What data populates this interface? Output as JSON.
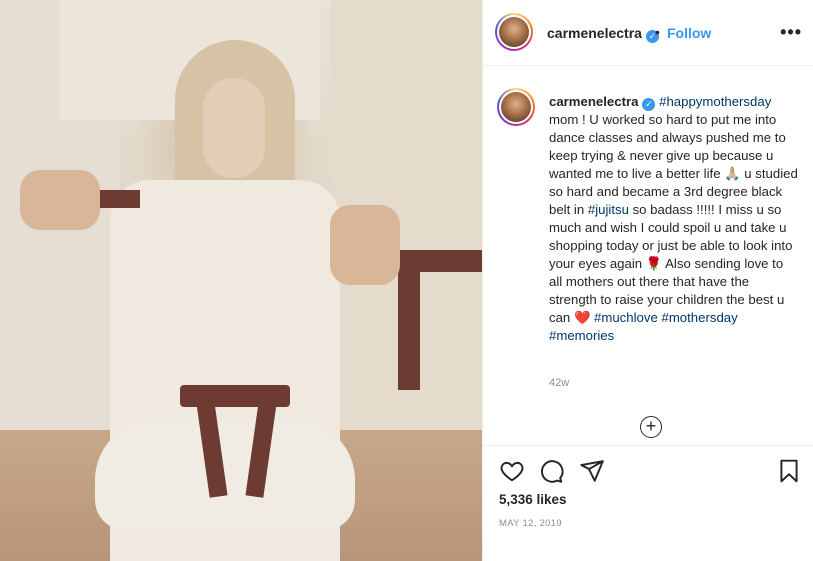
{
  "post": {
    "username": "carmenelectra",
    "verified_badge": "✓",
    "separator": "•",
    "follow_label": "Follow",
    "more_label": "•••",
    "caption_parts": [
      {
        "type": "text",
        "value": " "
      },
      {
        "type": "tag",
        "value": "#happymothersday"
      },
      {
        "type": "text",
        "value": " mom ! U worked so hard to put me into dance classes and always pushed me to keep trying & never give up because u wanted me to live a better life "
      },
      {
        "type": "emoji",
        "value": "🙏🏼"
      },
      {
        "type": "text",
        "value": " u studied so hard and became a 3rd degree black belt in "
      },
      {
        "type": "tag",
        "value": "#jujitsu"
      },
      {
        "type": "text",
        "value": " so badass !!!!! I miss u so much and wish I could spoil u and take u shopping today or just be able to look into your eyes again "
      },
      {
        "type": "emoji",
        "value": "🌹"
      },
      {
        "type": "text",
        "value": " Also sending love to all mothers out there that have the strength to raise your children the best u can "
      },
      {
        "type": "emoji",
        "value": "❤️"
      },
      {
        "type": "text",
        "value": " "
      },
      {
        "type": "tag",
        "value": "#muchlove"
      },
      {
        "type": "text",
        "value": " "
      },
      {
        "type": "tag",
        "value": "#mothersday"
      },
      {
        "type": "text",
        "value": " "
      },
      {
        "type": "tag",
        "value": "#memories"
      }
    ],
    "time_ago": "42w",
    "load_more_label": "+",
    "likes": "5,336 likes",
    "date": "MAY 12, 2019"
  },
  "colors": {
    "link_blue": "#3897f0",
    "hashtag": "#00376b",
    "muted": "#8e8e8e",
    "text": "#262626"
  },
  "icons": {
    "like": "heart-icon",
    "comment": "comment-icon",
    "share": "paper-plane-icon",
    "save": "bookmark-icon",
    "verified": "verified-badge-icon",
    "more": "more-options-icon",
    "load_more": "plus-circle-icon"
  }
}
